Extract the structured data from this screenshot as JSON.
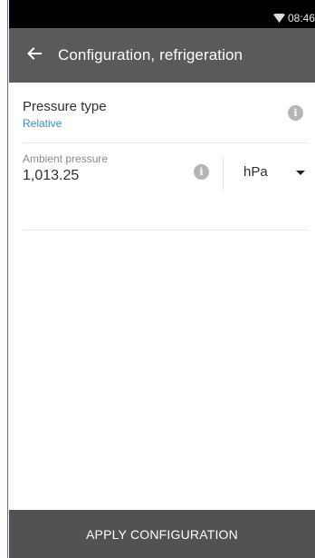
{
  "status_bar": {
    "time": "08:46",
    "wifi_icon": "wifi-icon"
  },
  "toolbar": {
    "back_icon": "arrow-left-icon",
    "title": "Configuration, refrigeration"
  },
  "pressure_type": {
    "label": "Pressure type",
    "value": "Relative",
    "info_icon": "info-icon"
  },
  "ambient_pressure": {
    "label": "Ambient pressure",
    "value": "1,013.25",
    "unit": "hPa",
    "info_icon": "info-icon"
  },
  "apply_button": {
    "label": "APPLY CONFIGURATION"
  },
  "colors": {
    "toolbar": "#5a5a5a",
    "status_bar": "#000000",
    "accent_value": "#3e8ac7",
    "apply_button": "#525252"
  }
}
